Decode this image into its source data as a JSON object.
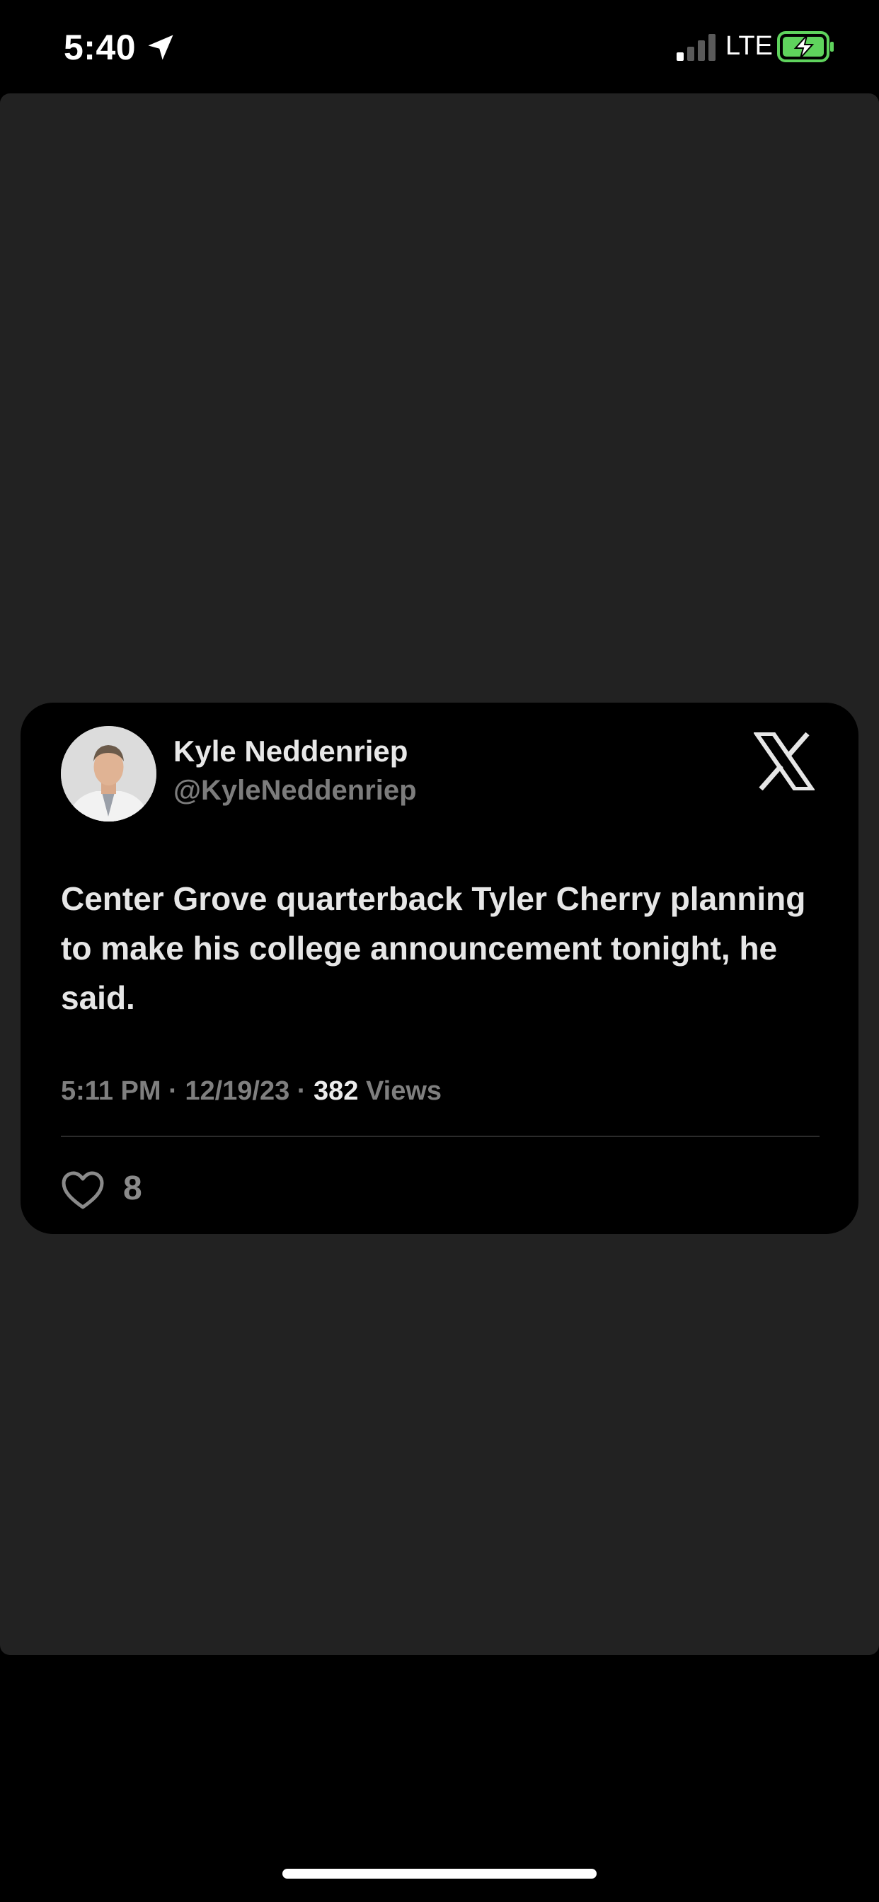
{
  "status_bar": {
    "time": "5:40",
    "network": "LTE",
    "signal_bars_active": 1,
    "signal_bars_total": 4,
    "battery_charging": true,
    "battery_color": "#5fd35d"
  },
  "tweet": {
    "author_name": "Kyle Neddenriep",
    "author_handle": "@KyleNeddenriep",
    "text": "Center Grove quarterback Tyler Cherry planning to make his college announcement tonight, he said.",
    "time": "5:11 PM",
    "date": "12/19/23",
    "views_count": "382",
    "views_label": "Views",
    "separator": " · ",
    "likes": "8"
  },
  "icons": {
    "location": "location-arrow-icon",
    "brand": "x-logo-icon",
    "like": "heart-icon"
  },
  "colors": {
    "background": "#000000",
    "content_bg": "#222222",
    "card_bg": "#000000"
  }
}
